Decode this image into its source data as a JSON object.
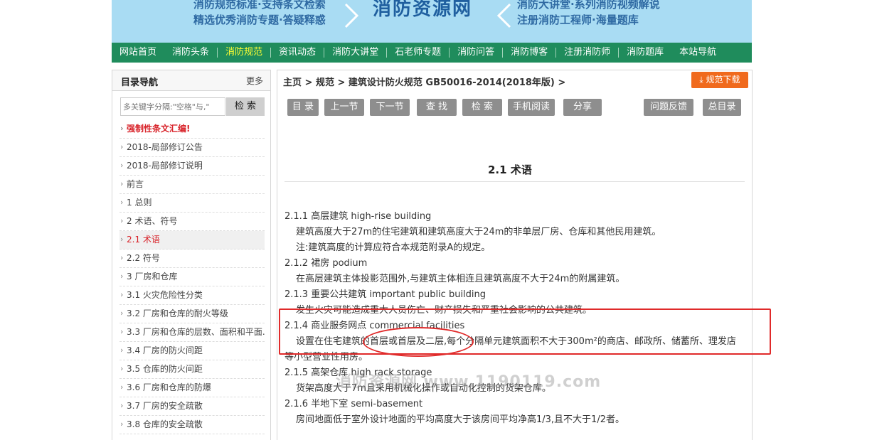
{
  "banner": {
    "left_line1": "消防规范标准·支持条文检索",
    "left_line2": "精选优秀消防专题·答疑释惑",
    "center": "消防资源网",
    "right_line1": "消防大讲堂·系列消防视频解说",
    "right_line2": "注册消防工程师·海量题库"
  },
  "nav": {
    "items": [
      "网站首页",
      "消防头条",
      "消防规范",
      "资讯动态",
      "消防大讲堂",
      "石老师专题",
      "消防问答",
      "消防博客",
      "注册消防师",
      "消防题库",
      "本站导航"
    ],
    "active_index": 2
  },
  "sidebar": {
    "title": "目录导航",
    "more": "更多",
    "search_placeholder": "多关键字分隔:\"空格\"与,\"",
    "search_button": "检 索",
    "items": [
      "强制性条文汇编!",
      "2018-局部修订公告",
      "2018-局部修订说明",
      "前言",
      "1 总则",
      "2 术语、符号",
      "2.1 术语",
      "2.2 符号",
      "3 厂房和仓库",
      "3.1 火灾危险性分类",
      "3.2 厂房和仓库的耐火等级",
      "3.3 厂房和仓库的层数、面积和平面...",
      "3.4 厂房的防火间距",
      "3.5 仓库的防火间距",
      "3.6 厂房和仓库的防爆",
      "3.7 厂房的安全疏散",
      "3.8 仓库的安全疏散"
    ],
    "highlight_index": 0,
    "current_index": 6
  },
  "main": {
    "breadcrumb": "主页 > 规范 > 建筑设计防火规范 GB50016-2014(2018年版) >",
    "download": "规范下载",
    "toolbar": [
      "目 录",
      "上一节",
      "下一节",
      "查 找",
      "检 索",
      "手机阅读",
      "分享",
      "问题反馈",
      "总目录"
    ],
    "heading": "2.1 术语",
    "lines": [
      {
        "text": "2.1.1 高层建筑 high-rise building",
        "indent": false
      },
      {
        "text": "建筑高度大于27m的住宅建筑和建筑高度大于24m的非单层厂房、仓库和其他民用建筑。",
        "indent": true
      },
      {
        "text": "注:建筑高度的计算应符合本规范附录A的规定。",
        "indent": true
      },
      {
        "text": "2.1.2 裙房 podium",
        "indent": false
      },
      {
        "text": "在高层建筑主体投影范围外,与建筑主体相连且建筑高度不大于24m的附属建筑。",
        "indent": true
      },
      {
        "text": "2.1.3 重要公共建筑 important public building",
        "indent": false
      },
      {
        "text": "发生火灾可能造成重大人员伤亡、财产损失和严重社会影响的公共建筑。",
        "indent": true
      },
      {
        "text": "2.1.4 商业服务网点 commercial facilities",
        "indent": false
      },
      {
        "text": "设置在住宅建筑的首层或首层及二层,每个分隔单元建筑面积不大于300m²的商店、邮政所、储蓄所、理发店",
        "indent": true
      },
      {
        "text": "等小型营业性用房。",
        "indent": false
      },
      {
        "text": "2.1.5 高架仓库 high rack storage",
        "indent": false
      },
      {
        "text": "货架高度大于7m且采用机械化操作或自动化控制的货架仓库。",
        "indent": true
      },
      {
        "text": "2.1.6 半地下室 semi-basement",
        "indent": false
      },
      {
        "text": "房间地面低于室外设计地面的平均高度大于该房间平均净高1/3,且不大于1/2者。",
        "indent": true
      }
    ],
    "watermark": "消防资源网 www.1190119.com"
  },
  "colors": {
    "nav_bg": "#1f8c5c",
    "nav_active": "#ffff33",
    "banner_bg": "#a9dcf3",
    "accent_orange": "#f06a1d",
    "annotation_red": "#e02a2a",
    "toolbar_gray": "#8e8e8e"
  }
}
